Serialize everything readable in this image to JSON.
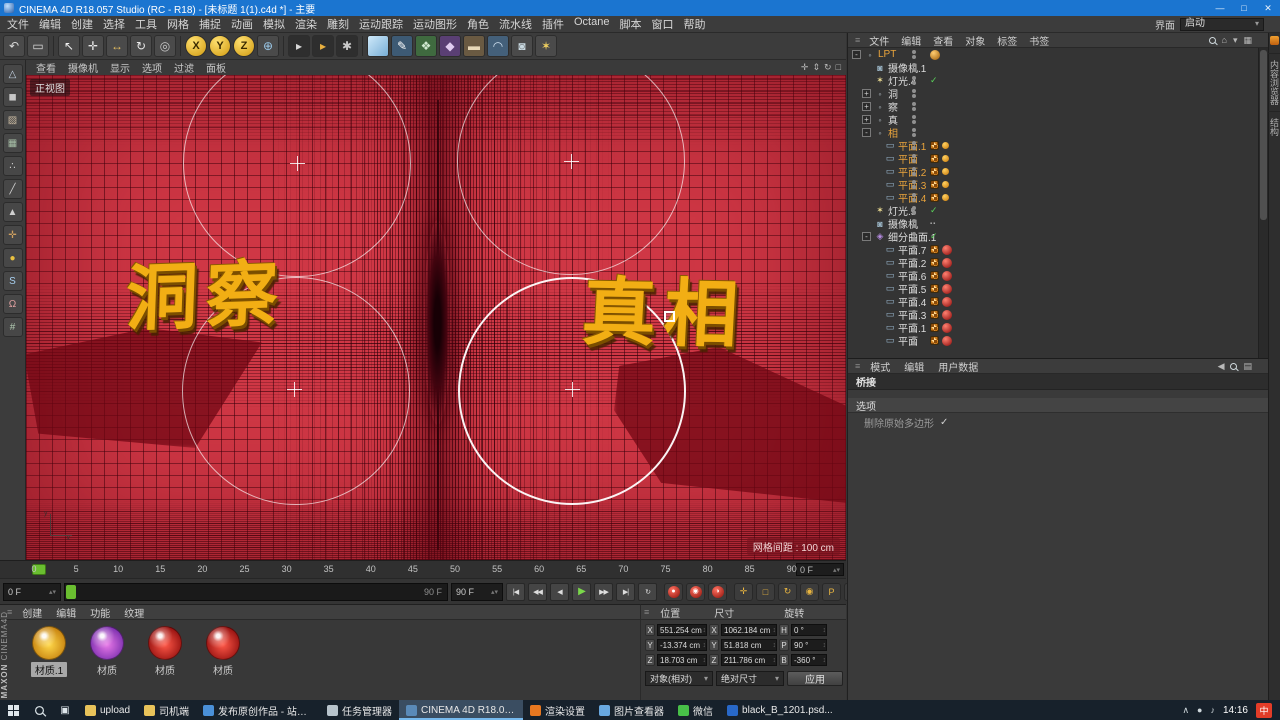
{
  "window": {
    "title": "CINEMA 4D R18.057 Studio (RC - R18) - [未标题 1(1).c4d *] - 主要",
    "controls": {
      "min": "—",
      "max": "□",
      "close": "✕"
    }
  },
  "menu_bar": {
    "items": [
      "文件",
      "编辑",
      "创建",
      "选择",
      "工具",
      "网格",
      "捕捉",
      "动画",
      "模拟",
      "渲染",
      "雕刻",
      "运动跟踪",
      "运动图形",
      "角色",
      "流水线",
      "插件",
      "Octane",
      "脚本",
      "窗口",
      "帮助"
    ],
    "interface_label": "界面",
    "interface_value": "启动"
  },
  "toolbar": {
    "icons": [
      {
        "name": "undo-button",
        "glyph": "↶"
      },
      {
        "name": "frame-selection-button",
        "glyph": "▭"
      },
      {
        "sep": true
      },
      {
        "name": "live-selection-button",
        "glyph": "↖",
        "fg": "#f0f0f0"
      },
      {
        "name": "move-button",
        "glyph": "✛",
        "fg": "#e8e8e8"
      },
      {
        "name": "scale-button",
        "glyph": "↔",
        "fg": "#e8c060"
      },
      {
        "name": "rotate-button",
        "glyph": "↻",
        "fg": "#e8e8e8"
      },
      {
        "name": "last-tool-button",
        "glyph": "◎",
        "fg": "#c8c8c8"
      },
      {
        "sep": true
      },
      {
        "name": "x-axis-button",
        "glyph": "X",
        "cls": "axis"
      },
      {
        "name": "y-axis-button",
        "glyph": "Y",
        "cls": "axis"
      },
      {
        "name": "z-axis-button",
        "glyph": "Z",
        "cls": "axis"
      },
      {
        "name": "coordinate-system-button",
        "glyph": "⊕",
        "fg": "#9ac8e8"
      },
      {
        "sep": true
      },
      {
        "name": "render-view-button",
        "glyph": "▸",
        "bg": "#2e2e2e",
        "fg": "#d8d8d8"
      },
      {
        "name": "render-picture-viewer-button",
        "glyph": "▸",
        "bg": "#2e2e2e",
        "fg": "#e8b040"
      },
      {
        "name": "render-settings-button",
        "glyph": "✱",
        "bg": "#2e2e2e",
        "fg": "#c8c8c8"
      },
      {
        "sep": true
      },
      {
        "name": "add-cube-button",
        "glyph": "",
        "bg": "linear-gradient(135deg,#cfe9fa,#78aed6)"
      },
      {
        "name": "pen-tool-button",
        "glyph": "✎",
        "bg": "#3d5a74",
        "fg": "#ffffff"
      },
      {
        "name": "mograph-button",
        "glyph": "❖",
        "bg": "#3f6a3f",
        "fg": "#cfe8cf"
      },
      {
        "name": "deformer-button",
        "glyph": "◆",
        "bg": "#5a3f74",
        "fg": "#e0ccf0"
      },
      {
        "name": "floor-button",
        "glyph": "▬",
        "bg": "#6a5a42",
        "fg": "#e8d8b8"
      },
      {
        "name": "sky-button",
        "glyph": "◠",
        "bg": "#44607a",
        "fg": "#cfe0f0"
      },
      {
        "name": "camera-button",
        "glyph": "◙",
        "fg": "#c8d8e0"
      },
      {
        "name": "light-button",
        "glyph": "✶",
        "fg": "#f0d060"
      }
    ]
  },
  "left_tools": {
    "icons": [
      {
        "name": "make-editable-button",
        "glyph": "△",
        "fg": "#c8d8e8"
      },
      {
        "name": "model-mode-button",
        "glyph": "◼",
        "fg": "#c8c8c8"
      },
      {
        "name": "texture-mode-button",
        "glyph": "▨",
        "fg": "#c8b8a0"
      },
      {
        "name": "workplane-mode-button",
        "glyph": "▦",
        "fg": "#a8c0a8"
      },
      {
        "name": "point-mode-button",
        "glyph": "∴",
        "fg": "#d0d0d0"
      },
      {
        "name": "edge-mode-button",
        "glyph": "╱",
        "fg": "#d0d0d0"
      },
      {
        "name": "polygon-mode-button",
        "glyph": "▲",
        "fg": "#d0d0d0"
      },
      {
        "name": "axis-mode-button",
        "glyph": "✛",
        "fg": "#d0a060"
      },
      {
        "name": "lock-axis-button",
        "glyph": "●",
        "fg": "#e8c040"
      },
      {
        "name": "snap-button",
        "glyph": "S",
        "fg": "#a8d0f0"
      },
      {
        "name": "magnet-button",
        "glyph": "Ω",
        "fg": "#e0a0a0"
      },
      {
        "name": "grid-snap-button",
        "glyph": "#",
        "fg": "#b0c8b0"
      }
    ]
  },
  "viewport": {
    "menu": [
      "查看",
      "摄像机",
      "显示",
      "选项",
      "过滤",
      "面板"
    ],
    "nav_icons": [
      {
        "name": "pan-view-icon",
        "glyph": "✛"
      },
      {
        "name": "zoom-view-icon",
        "glyph": "⇕"
      },
      {
        "name": "rotate-view-icon",
        "glyph": "↻"
      },
      {
        "name": "toggle-view-icon",
        "glyph": "□"
      }
    ],
    "view_label": "正视图",
    "grid_spacing_label": "网格间距 : 100 cm",
    "text_left": "洞察",
    "text_right": "真相"
  },
  "timeline": {
    "ticks": [
      "0",
      "5",
      "10",
      "15",
      "20",
      "25",
      "30",
      "35",
      "40",
      "45",
      "50",
      "55",
      "60",
      "65",
      "70",
      "75",
      "80",
      "85",
      "90"
    ],
    "current": "0 F",
    "slider_value": "90 F",
    "range_end": "90 F",
    "transport": [
      {
        "name": "goto-start-button",
        "glyph": "|◀"
      },
      {
        "name": "prev-key-button",
        "glyph": "◀◀"
      },
      {
        "name": "prev-frame-button",
        "glyph": "◀"
      },
      {
        "name": "play-button",
        "glyph": "▶",
        "cls": "play"
      },
      {
        "name": "next-key-button",
        "glyph": "▶▶"
      },
      {
        "name": "goto-end-button",
        "glyph": "▶|"
      },
      {
        "name": "loop-button",
        "glyph": "↻"
      }
    ],
    "record": [
      {
        "name": "record-keyframe-button",
        "glyph": "●"
      },
      {
        "name": "autokey-button",
        "glyph": "◉"
      },
      {
        "name": "record-options-button",
        "glyph": "◑"
      }
    ],
    "keys": [
      {
        "name": "key-position-button",
        "glyph": "✛"
      },
      {
        "name": "key-scale-button",
        "glyph": "□"
      },
      {
        "name": "key-rotation-button",
        "glyph": "↻"
      },
      {
        "name": "key-parameter-button",
        "glyph": "◉"
      },
      {
        "name": "key-pla-button",
        "glyph": "P"
      },
      {
        "name": "key-filter-button",
        "glyph": "▦"
      }
    ],
    "layout_button_glyph": "▤"
  },
  "materials": {
    "menu": [
      "创建",
      "编辑",
      "功能",
      "纹理"
    ],
    "items": [
      {
        "name": "材质.1",
        "c1": "#ffd84a",
        "c2": "#c07808",
        "selected": true
      },
      {
        "name": "材质",
        "c1": "#e878e8",
        "c2": "#7028a8",
        "selected": false
      },
      {
        "name": "材质",
        "c1": "#ff5848",
        "c2": "#8a0a0a",
        "selected": false
      },
      {
        "name": "材质",
        "c1": "#ff5848",
        "c2": "#8a0a0a",
        "selected": false
      }
    ]
  },
  "brand": {
    "line1": "MAXON",
    "line2": "CINEMA4D"
  },
  "coordinates": {
    "groups": [
      "位置",
      "尺寸",
      "旋转"
    ],
    "rows": [
      {
        "pos_label": "X",
        "pos": "551.254 cm",
        "size_label": "X",
        "size": "1062.184 cm",
        "rot_label": "H",
        "rot": "0 °"
      },
      {
        "pos_label": "Y",
        "pos": "-13.374 cm",
        "size_label": "Y",
        "size": "51.818 cm",
        "rot_label": "P",
        "rot": "90 °"
      },
      {
        "pos_label": "Z",
        "pos": "18.703 cm",
        "size_label": "Z",
        "size": "211.786 cm",
        "rot_label": "B",
        "rot": "-360 °"
      }
    ],
    "mode": "对象(相对)",
    "size_mode": "绝对尺寸",
    "apply": "应用"
  },
  "object_manager": {
    "menu": [
      "文件",
      "编辑",
      "查看",
      "对象",
      "标签",
      "书签"
    ],
    "icons": [
      {
        "name": "search-icon",
        "type": "mag"
      },
      {
        "name": "home-icon",
        "glyph": "⌂"
      },
      {
        "name": "dropdown-icon",
        "glyph": "▾"
      },
      {
        "name": "filter-icon",
        "glyph": "▦"
      }
    ],
    "tree": [
      {
        "indent": 0,
        "exp": "-",
        "icon": "null",
        "name": "LPT",
        "orange": true,
        "badges": [
          "sph-o"
        ]
      },
      {
        "indent": 1,
        "exp": "",
        "icon": "camera",
        "name": "摄像机.1",
        "orange": false,
        "badges": []
      },
      {
        "indent": 1,
        "exp": "",
        "icon": "light",
        "name": "灯光.4",
        "orange": false,
        "badges": [
          "check"
        ]
      },
      {
        "indent": 1,
        "exp": "+",
        "icon": "null",
        "name": "洞",
        "orange": false,
        "badges": []
      },
      {
        "indent": 1,
        "exp": "+",
        "icon": "null",
        "name": "察",
        "orange": false,
        "badges": []
      },
      {
        "indent": 1,
        "exp": "+",
        "icon": "null",
        "name": "真",
        "orange": false,
        "badges": []
      },
      {
        "indent": 1,
        "exp": "-",
        "icon": "null",
        "name": "相",
        "orange": true,
        "badges": []
      },
      {
        "indent": 2,
        "exp": "",
        "icon": "plane",
        "name": "平面.1",
        "orange": true,
        "badges": [
          "mat",
          "dot"
        ]
      },
      {
        "indent": 2,
        "exp": "",
        "icon": "plane",
        "name": "平面",
        "orange": true,
        "badges": [
          "mat",
          "dot"
        ]
      },
      {
        "indent": 2,
        "exp": "",
        "icon": "plane",
        "name": "平面.2",
        "orange": true,
        "badges": [
          "mat",
          "dot"
        ]
      },
      {
        "indent": 2,
        "exp": "",
        "icon": "plane",
        "name": "平面.3",
        "orange": true,
        "badges": [
          "mat",
          "dot"
        ]
      },
      {
        "indent": 2,
        "exp": "",
        "icon": "plane",
        "name": "平面.4",
        "orange": true,
        "badges": [
          "mat",
          "dot"
        ]
      },
      {
        "indent": 1,
        "exp": "",
        "icon": "light",
        "name": "灯光.5",
        "orange": false,
        "badges": [
          "check"
        ]
      },
      {
        "indent": 1,
        "exp": "",
        "icon": "camera",
        "name": "摄像机",
        "orange": false,
        "badges": [
          "camdots"
        ]
      },
      {
        "indent": 1,
        "exp": "-",
        "icon": "subdiv",
        "name": "细分曲面.1",
        "orange": false,
        "badges": [
          "check"
        ]
      },
      {
        "indent": 2,
        "exp": "",
        "icon": "plane",
        "name": "平面.7",
        "orange": false,
        "badges": [
          "mat",
          "sph-r"
        ]
      },
      {
        "indent": 2,
        "exp": "",
        "icon": "plane",
        "name": "平面.2",
        "orange": false,
        "badges": [
          "mat",
          "sph-r"
        ]
      },
      {
        "indent": 2,
        "exp": "",
        "icon": "plane",
        "name": "平面.6",
        "orange": false,
        "badges": [
          "mat",
          "sph-r"
        ]
      },
      {
        "indent": 2,
        "exp": "",
        "icon": "plane",
        "name": "平面.5",
        "orange": false,
        "badges": [
          "mat",
          "sph-r"
        ]
      },
      {
        "indent": 2,
        "exp": "",
        "icon": "plane",
        "name": "平面.4",
        "orange": false,
        "badges": [
          "mat",
          "sph-r"
        ]
      },
      {
        "indent": 2,
        "exp": "",
        "icon": "plane",
        "name": "平面.3",
        "orange": false,
        "badges": [
          "mat",
          "sph-r"
        ]
      },
      {
        "indent": 2,
        "exp": "",
        "icon": "plane",
        "name": "平面.1",
        "orange": false,
        "badges": [
          "mat",
          "sph-r"
        ]
      },
      {
        "indent": 2,
        "exp": "",
        "icon": "plane",
        "name": "平面",
        "orange": false,
        "badges": [
          "mat",
          "sph-r"
        ]
      }
    ]
  },
  "attributes": {
    "tabs": [
      "模式",
      "编辑",
      "用户数据"
    ],
    "icons": [
      {
        "name": "back-icon",
        "glyph": "◀"
      },
      {
        "name": "search-icon",
        "type": "mag"
      },
      {
        "name": "panel-icon",
        "glyph": "▤"
      }
    ],
    "object_title": "桥接",
    "section": "选项",
    "options": [
      {
        "label": "删除原始多边形",
        "check": "✓"
      }
    ]
  },
  "edge_tabs": [
    "内容浏览器",
    "结构"
  ],
  "taskbar": {
    "system": [
      {
        "name": "start-button",
        "type": "winlogo"
      },
      {
        "name": "search-button",
        "type": "mag"
      },
      {
        "name": "task-view-button",
        "glyph": "▣"
      }
    ],
    "items": [
      {
        "label": "upload",
        "ic": "#e8c35a",
        "active": false
      },
      {
        "label": "司机端",
        "ic": "#e8c35a",
        "active": false
      },
      {
        "label": "发布原创作品 - 站酷...",
        "ic": "#4a90d8",
        "active": false
      },
      {
        "label": "任务管理器",
        "ic": "#b8c4cc",
        "active": false
      },
      {
        "label": "CINEMA 4D R18.05...",
        "ic": "#5a8ab8",
        "active": true
      },
      {
        "label": "渲染设置",
        "ic": "#e87820",
        "active": false
      },
      {
        "label": "图片查看器",
        "ic": "#68a8e0",
        "active": false
      },
      {
        "label": "微信",
        "ic": "#48c048",
        "active": false
      },
      {
        "label": "black_B_1201.psd...",
        "ic": "#2868c8",
        "active": false
      }
    ],
    "tray_icons": [
      "∧",
      "●",
      "♪"
    ],
    "time": "14:16",
    "badge": "中"
  }
}
